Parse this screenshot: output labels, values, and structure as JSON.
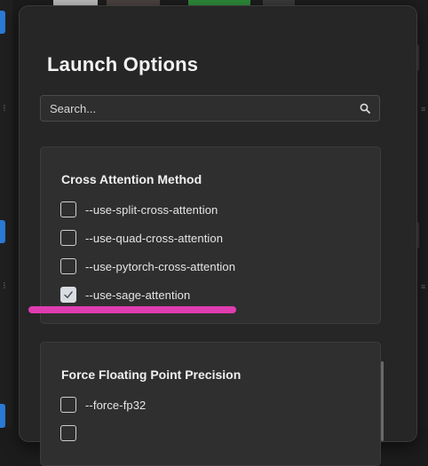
{
  "dialog": {
    "title": "Launch Options",
    "search": {
      "placeholder": "Search...",
      "value": ""
    }
  },
  "groups": [
    {
      "title": "Cross Attention Method",
      "options": [
        {
          "label": "--use-split-cross-attention",
          "checked": false
        },
        {
          "label": "--use-quad-cross-attention",
          "checked": false
        },
        {
          "label": "--use-pytorch-cross-attention",
          "checked": false
        },
        {
          "label": "--use-sage-attention",
          "checked": true
        }
      ]
    },
    {
      "title": "Force Floating Point Precision",
      "options": [
        {
          "label": "--force-fp32",
          "checked": false
        }
      ]
    }
  ],
  "colors": {
    "highlight": "#f03ebd",
    "dialog_bg": "#262626",
    "group_bg": "#2f2f2f"
  },
  "icons": [
    "search-icon",
    "checkmark-icon"
  ]
}
